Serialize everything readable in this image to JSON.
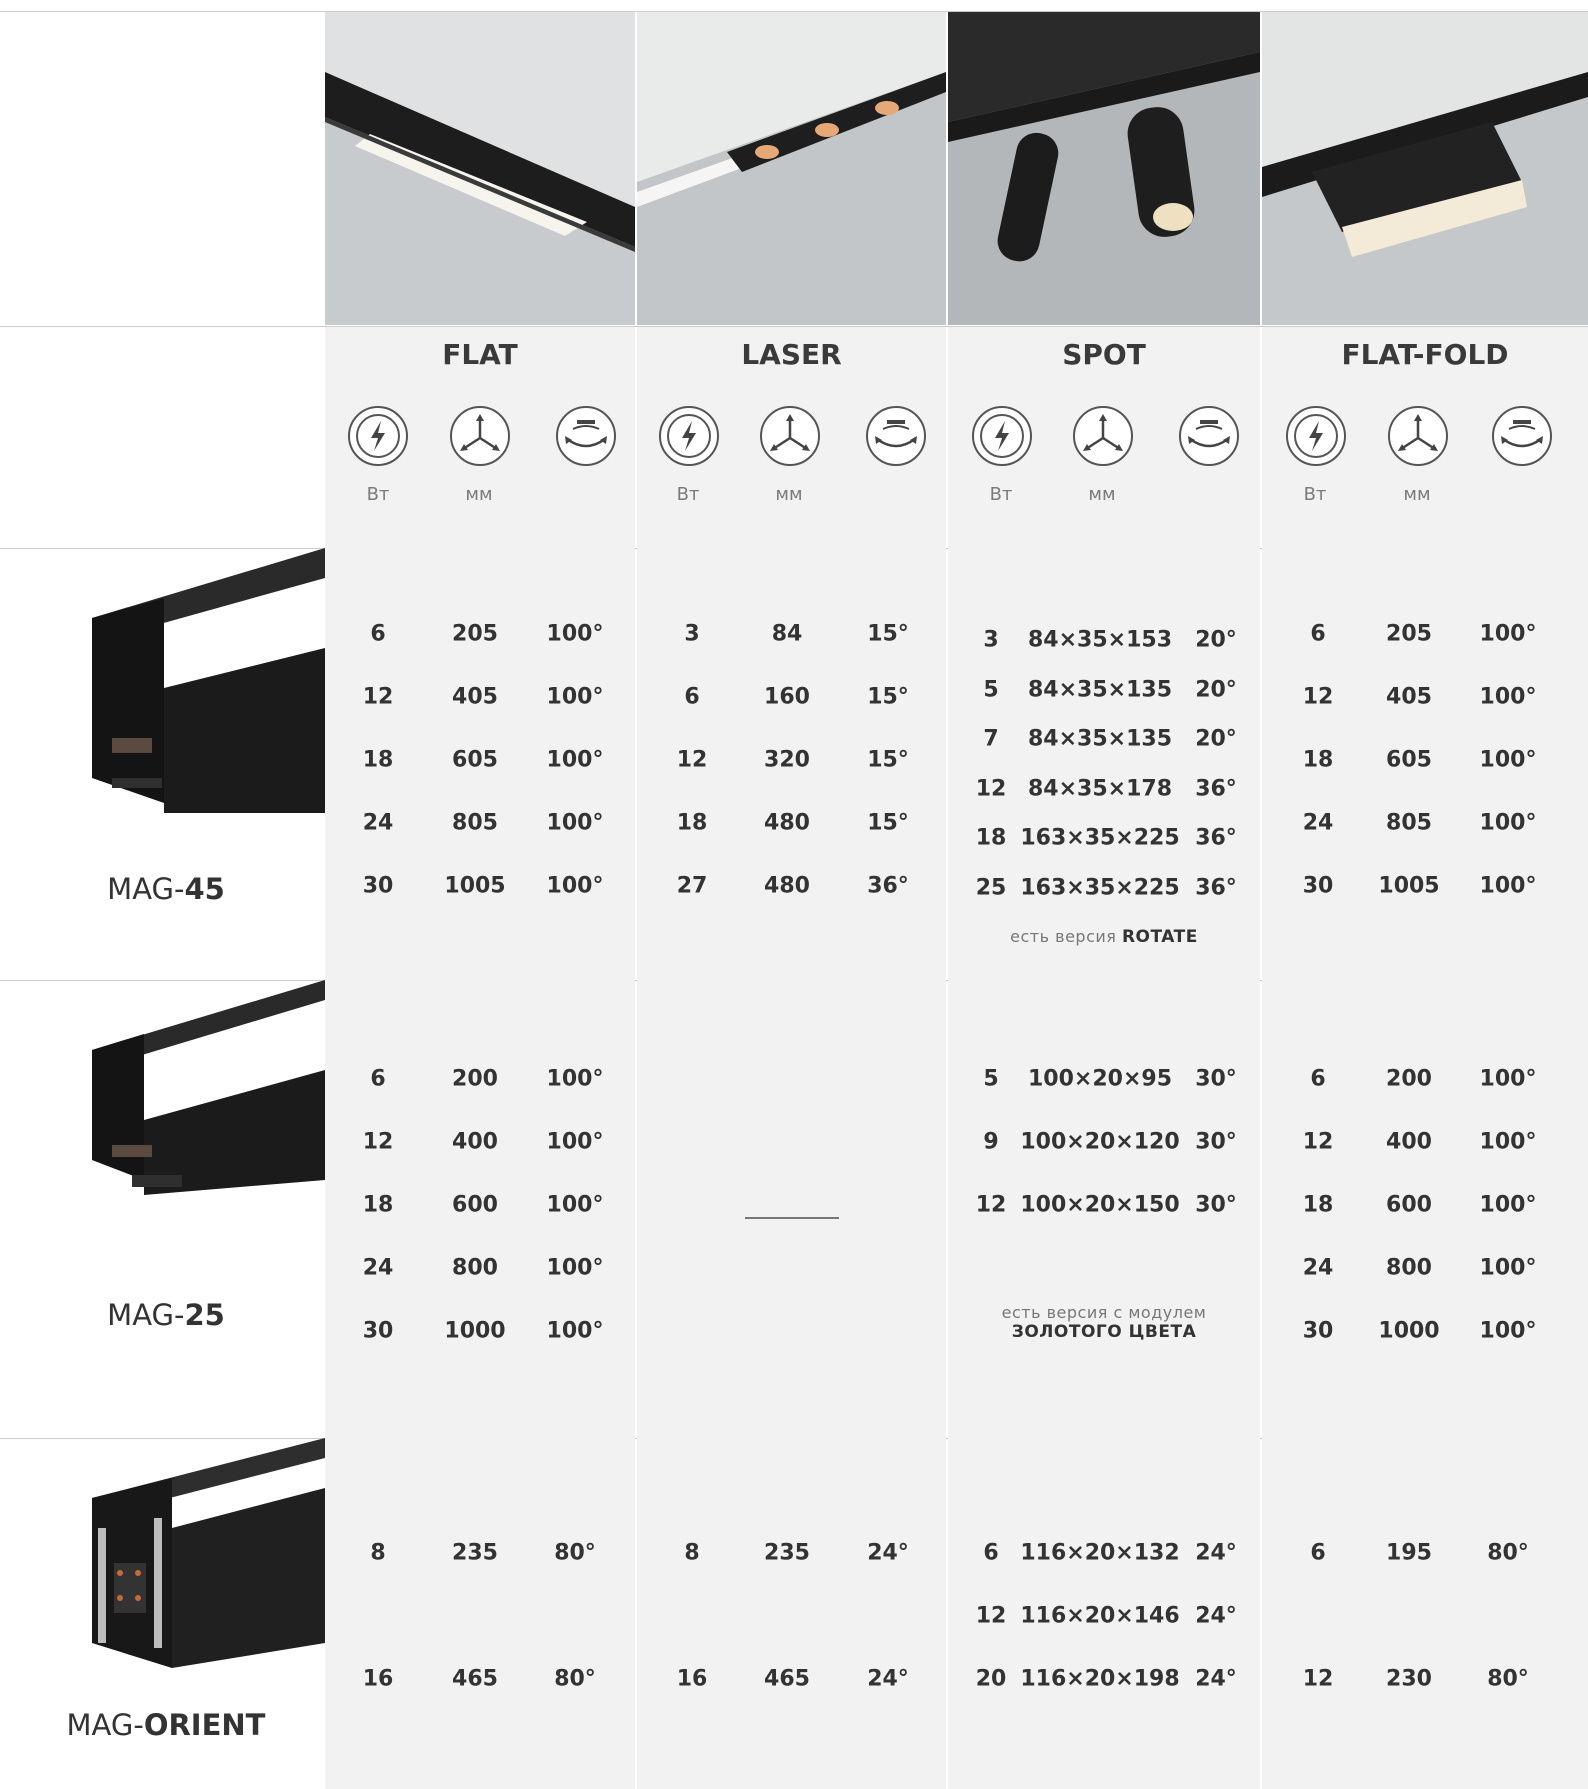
{
  "families": [
    {
      "id": "flat",
      "title": "FLAT",
      "units": [
        "Вт",
        "мм",
        ""
      ]
    },
    {
      "id": "laser",
      "title": "LASER",
      "units": [
        "Вт",
        "мм",
        ""
      ]
    },
    {
      "id": "spot",
      "title": "SPOT",
      "units": [
        "Вт",
        "мм",
        ""
      ]
    },
    {
      "id": "flatfold",
      "title": "FLAT-FOLD",
      "units": [
        "Вт",
        "мм",
        ""
      ]
    }
  ],
  "icons": [
    "power-icon",
    "dimensions-icon",
    "beam-angle-icon"
  ],
  "tracks": [
    {
      "label_prefix": "MAG-",
      "label_bold": "45",
      "flat": [
        [
          "6",
          "205",
          "100°"
        ],
        [
          "12",
          "405",
          "100°"
        ],
        [
          "18",
          "605",
          "100°"
        ],
        [
          "24",
          "805",
          "100°"
        ],
        [
          "30",
          "1005",
          "100°"
        ]
      ],
      "laser": [
        [
          "3",
          "84",
          "15°"
        ],
        [
          "6",
          "160",
          "15°"
        ],
        [
          "12",
          "320",
          "15°"
        ],
        [
          "18",
          "480",
          "15°"
        ],
        [
          "27",
          "480",
          "36°"
        ]
      ],
      "spot": [
        [
          "3",
          "84×35×153",
          "20°"
        ],
        [
          "5",
          "84×35×135",
          "20°"
        ],
        [
          "7",
          "84×35×135",
          "20°"
        ],
        [
          "12",
          "84×35×178",
          "36°"
        ],
        [
          "18",
          "163×35×225",
          "36°"
        ],
        [
          "25",
          "163×35×225",
          "36°"
        ]
      ],
      "spot_note_text": "есть версия ",
      "spot_note_bold": "ROTATE",
      "flatfold": [
        [
          "6",
          "205",
          "100°"
        ],
        [
          "12",
          "405",
          "100°"
        ],
        [
          "18",
          "605",
          "100°"
        ],
        [
          "24",
          "805",
          "100°"
        ],
        [
          "30",
          "1005",
          "100°"
        ]
      ]
    },
    {
      "label_prefix": "MAG-",
      "label_bold": "25",
      "flat": [
        [
          "6",
          "200",
          "100°"
        ],
        [
          "12",
          "400",
          "100°"
        ],
        [
          "18",
          "600",
          "100°"
        ],
        [
          "24",
          "800",
          "100°"
        ],
        [
          "30",
          "1000",
          "100°"
        ]
      ],
      "laser": [],
      "spot": [
        [
          "5",
          "100×20×95",
          "30°"
        ],
        [
          "9",
          "100×20×120",
          "30°"
        ],
        [
          "12",
          "100×20×150",
          "30°"
        ]
      ],
      "spot_note_text": "есть версия с модулем",
      "spot_note_bold": "ЗОЛОТОГО ЦВЕТА",
      "flatfold": [
        [
          "6",
          "200",
          "100°"
        ],
        [
          "12",
          "400",
          "100°"
        ],
        [
          "18",
          "600",
          "100°"
        ],
        [
          "24",
          "800",
          "100°"
        ],
        [
          "30",
          "1000",
          "100°"
        ]
      ]
    },
    {
      "label_prefix": "MAG-",
      "label_bold": "ORIENT",
      "flat": [
        [
          "8",
          "235",
          "80°"
        ],
        [
          "16",
          "465",
          "80°"
        ]
      ],
      "laser": [
        [
          "8",
          "235",
          "24°"
        ],
        [
          "16",
          "465",
          "24°"
        ]
      ],
      "spot": [
        [
          "6",
          "116×20×132",
          "24°"
        ],
        [
          "12",
          "116×20×146",
          "24°"
        ],
        [
          "20",
          "116×20×198",
          "24°"
        ]
      ],
      "flatfold": [
        [
          "6",
          "195",
          "80°"
        ],
        [
          "12",
          "230",
          "80°"
        ]
      ]
    }
  ],
  "colors": {
    "column_bg": "#f1f2f1",
    "track_black": "#1c1c1c",
    "rule": "#c9cbcc"
  }
}
